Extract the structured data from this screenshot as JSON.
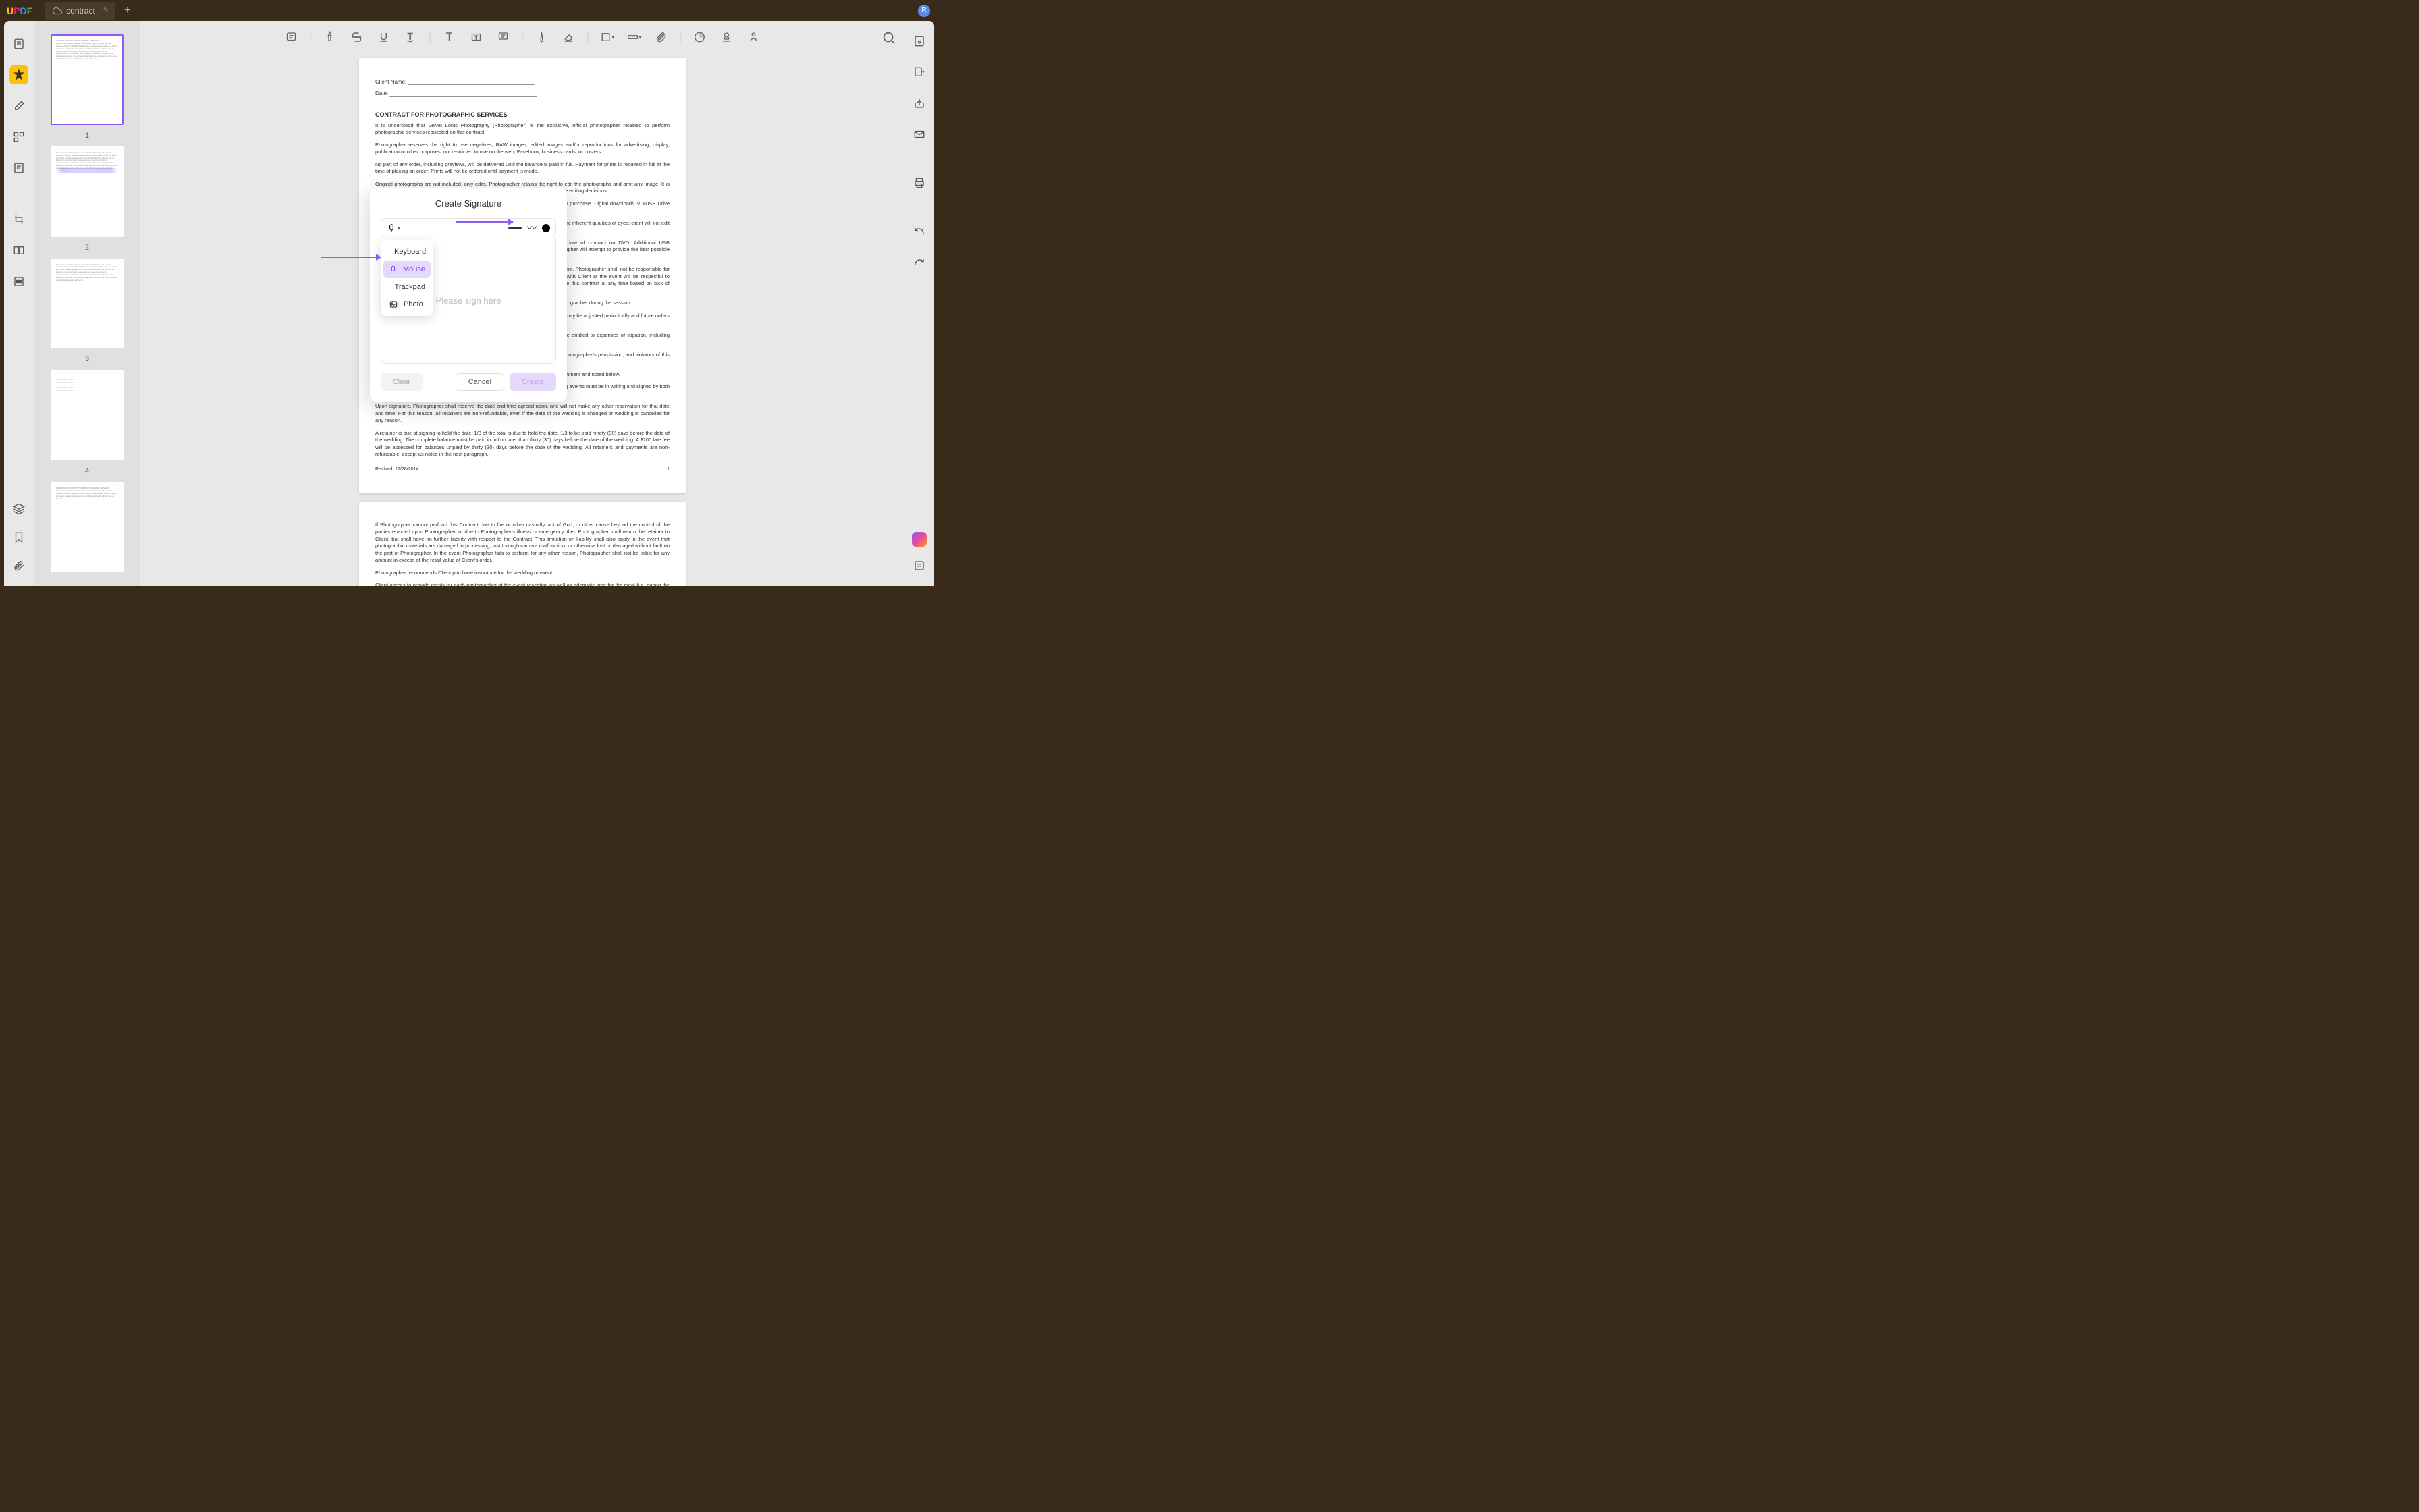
{
  "app": {
    "name": "UPDF"
  },
  "tab": {
    "title": "contract",
    "cloud": true
  },
  "user": {
    "initial": "R"
  },
  "thumbs": [
    {
      "page": "1",
      "selected": true
    },
    {
      "page": "2",
      "selected": false
    },
    {
      "page": "3",
      "selected": false
    },
    {
      "page": "4",
      "selected": false
    }
  ],
  "document": {
    "client_name_label": "Client Name: __________________________________________",
    "date_label": "Date: _________________________________________________",
    "heading": "CONTRACT FOR PHOTOGRAPHIC SERVICES",
    "p1": "It is understood that Velvet Lotus Photography (Photographer) is the exclusive, official photographer retained to perform photographic services requested on this contract.",
    "p2": "Photographer reserves the right to use negatives, RAW images, edited images and/or reproductions for advertising, display, publication or other purposes, not restricted to use on the web, Facebook, business cards, or posters.",
    "p3": "No part of any order, including previews, will be delivered until the balance is paid in full. Payment for prints is required in full at the time of placing an order. Prints will not be ordered until payment is made.",
    "p4": "Original photographs are not included, only edits. Photographer retains the right to edit the photographs and omit any image. It is understood that Photographer will not deliver every exposure taken, and will not share editing decisions.",
    "p5": "Client is obligated to pay for any wanted photographs included in the package they purchase. Digital download/DVD/USB Drive includes",
    "p6": "Client is aware that color dyes in photography may fade or discolor over time due to the inherent qualities of dyes; client will not edit the photos in any way, i.e.",
    "p7": "Client is aware that re-orders will only be available for up to 2 years from date of contract on DVD. Additional USB drives/CDs/DVDs may be available after your session at an additional cost. Photographer will attempt to provide the best possible photos, but does not guarantee they will be",
    "p8": "Photographer is limited by the rules, guidelines of the location(s) and site management. Photographer shall not be responsible for photographs not taken as a result of restrictions. Client and all those associated with Client at the event will be respectful to Photographer and all parties involved. Photographer reserves the right to terminate this contract at any time based on lack of cooperation or respect.",
    "p9": "Photographer is not responsible for missed images due to details not revealed to Photographer during the session.",
    "p10": "Prices listed are valid for 6 months after this date. Photography prices and packages may be adjusted periodically and future orders shall be charged at the prices in effect at the time the order is placed.",
    "p11": "If an agent asserts any claim to or against this event, the prevailing party shall be entitled to expenses of litigation, including reasonable attorney's fees.",
    "p12": "Client agrees that he/she will not sell any of the photographs or digital files without photographer's permission, and violators of this Federal Law will be subject to civil and criminal penalties.",
    "p13": "Additional items may be added to this contract. Prices and fees are listed on the attachment and noted below.",
    "p14": "Charges not paid by Client shall be default of the agreement. All contracts for wedding events must be in writing and signed by both parties.",
    "p15": "Upon signature, Photographer shall reserve the date and time agreed upon, and will not make any other reservation for that date and time. For this reason, all retainers are non-refundable, even if the date of the wedding is changed or wedding is cancelled for any reason.",
    "p16": "A retainer is due at signing to hold the date. 1/3 of the total is due to hold the date. 1/3 to be paid ninety (90) days before the date of the wedding. The complete balance must be paid in full no later than thirty (30) days before the date of the wedding. A $200 late fee will be assessed for balances unpaid by thirty (30) days before the date of the wedding. All retainers and payments are non-refundable, except as noted in the next paragraph.",
    "revised": "Revised: 12/28/2014",
    "pagenum": "1",
    "p2_1": "If Photographer cannot perform this Contract due to fire or other casualty, act of God, or other cause beyond the control of the parties enacted upon Photographer, or due to Photographer's illness or emergency, then Photographer shall return the retainer to Client, but shall have no further liability with respect to the Contract. This limitation on liability shall also apply in the event that photographic materials are damaged in processing, lost through camera malfunction, or otherwise lost or damaged without fault on the part of Photographer. In the event Photographer fails to perform for any other reason, Photographer shall not be liable for any amount in excess of the retail value of Client's order.",
    "p2_2": "Photographer recommends Client purchase insurance for the wedding or event.",
    "p2_3": "Client agrees to provide meals for each photographer at the event reception as well as adequate time for the meal (i.e. during the regular meal). For events longer than eight (8) hours, two (2) meals for each photographer will be provided."
  },
  "modal": {
    "title": "Create Signature",
    "placeholder": "Please sign here",
    "options": {
      "keyboard": "Keyboard",
      "mouse": "Mouse",
      "trackpad": "Trackpad",
      "photo": "Photo"
    },
    "buttons": {
      "clear": "Clear",
      "cancel": "Cancel",
      "create": "Create"
    }
  }
}
